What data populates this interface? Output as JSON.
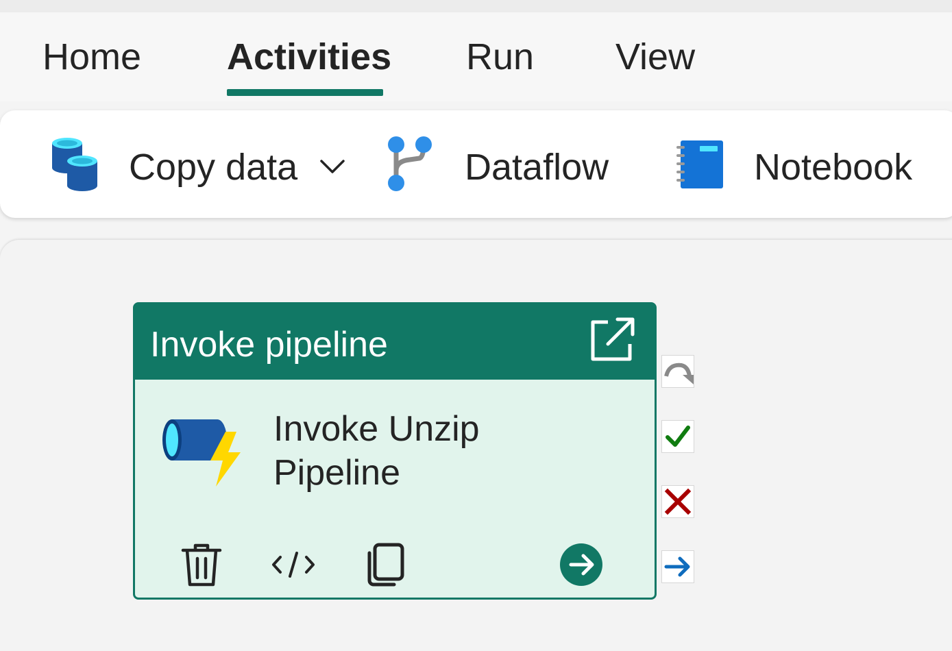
{
  "tabs": [
    {
      "label": "Home",
      "active": false
    },
    {
      "label": "Activities",
      "active": true
    },
    {
      "label": "Run",
      "active": false
    },
    {
      "label": "View",
      "active": false
    }
  ],
  "toolbar": {
    "copy_data": {
      "label": "Copy data",
      "icon": "database-copy-icon"
    },
    "dataflow": {
      "label": "Dataflow",
      "icon": "dataflow-icon"
    },
    "notebook": {
      "label": "Notebook",
      "icon": "notebook-icon"
    }
  },
  "activity": {
    "type_label": "Invoke pipeline",
    "name": "Invoke Unzip Pipeline",
    "actions": [
      "delete-icon",
      "code-icon",
      "copy-icon",
      "go-to-arrow-icon"
    ]
  },
  "side_connectors": [
    {
      "name": "on-skip-connector",
      "icon": "skip-arrow-icon"
    },
    {
      "name": "on-success-connector",
      "icon": "checkmark-icon"
    },
    {
      "name": "on-failure-connector",
      "icon": "x-mark-icon"
    },
    {
      "name": "on-completion-connector",
      "icon": "arrow-right-icon"
    }
  ],
  "colors": {
    "accent": "#117865",
    "activity_body": "#e1f4ec",
    "success": "#107c10",
    "failure": "#a80000",
    "completion": "#0f6cbd"
  }
}
